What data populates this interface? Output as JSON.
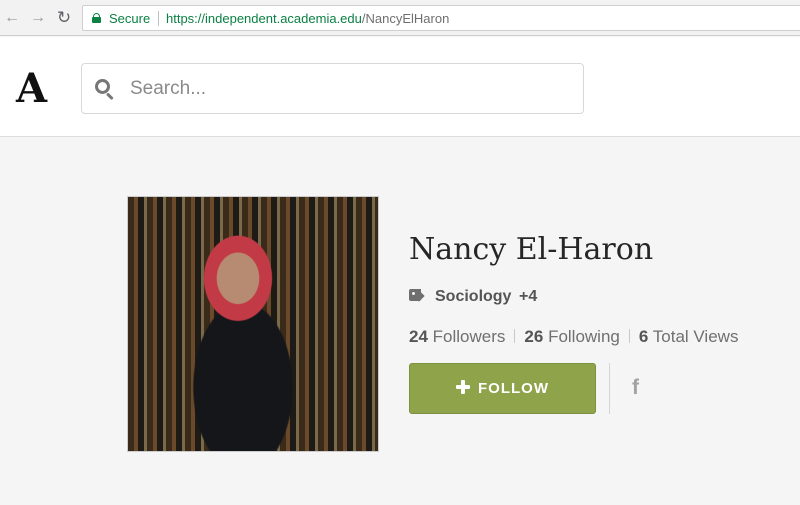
{
  "browser": {
    "secure_label": "Secure",
    "url_host": "https://independent.academia.edu",
    "url_path": "/NancyElHaron",
    "icons": {
      "back": "arrow-left-icon",
      "forward": "arrow-right-icon",
      "reload": "reload-icon",
      "lock": "lock-icon"
    }
  },
  "header": {
    "logo_text": "A",
    "search": {
      "placeholder": "Search...",
      "value": ""
    }
  },
  "profile": {
    "name": "Nancy El-Haron",
    "research_interest": "Sociology",
    "more_interests": "+4",
    "followers_count": "24",
    "followers_label": "Followers",
    "following_count": "26",
    "following_label": "Following",
    "views_count": "6",
    "views_label": "Total Views",
    "follow_label": "FOLLOW",
    "facebook_glyph": "f"
  },
  "colors": {
    "follow_button": "#8ea34a",
    "secure_green": "#0b8043",
    "background": "#f5f5f5"
  }
}
